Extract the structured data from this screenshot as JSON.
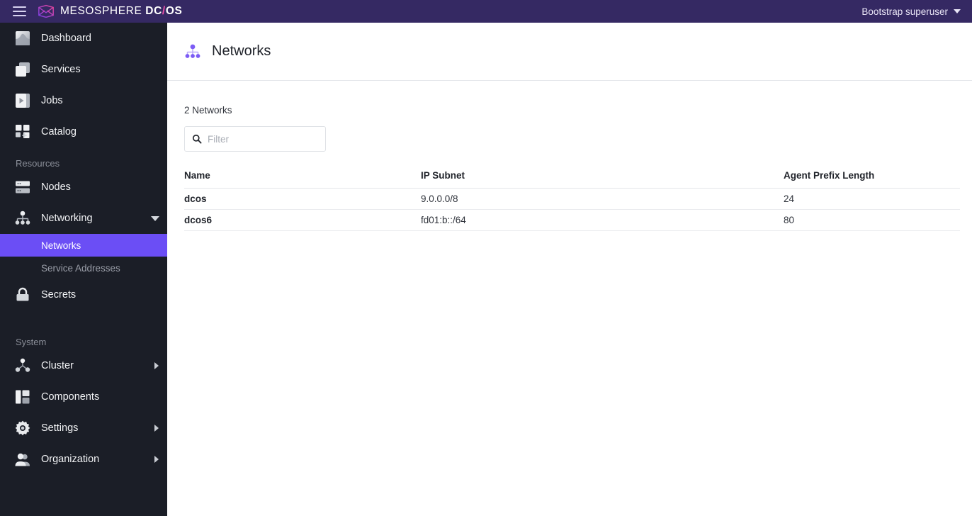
{
  "topbar": {
    "menu_icon": "hamburger-icon",
    "logo_icon": "mesosphere-envelope-logo",
    "brand_part1": "MESOSPHERE ",
    "brand_dc": "DC",
    "brand_slash": "/",
    "brand_os": "OS",
    "user_label": "Bootstrap superuser",
    "user_caret_icon": "chevron-down-icon",
    "background_color": "#352963"
  },
  "sidebar": {
    "background_color": "#1b1e27",
    "active_color": "#6b4ef5",
    "primary_items": [
      {
        "label": "Dashboard",
        "icon": "dashboard-icon"
      },
      {
        "label": "Services",
        "icon": "services-icon"
      },
      {
        "label": "Jobs",
        "icon": "jobs-icon"
      },
      {
        "label": "Catalog",
        "icon": "catalog-icon"
      }
    ],
    "resources_title": "Resources",
    "resources_items": [
      {
        "label": "Nodes",
        "icon": "nodes-icon"
      },
      {
        "label": "Networking",
        "icon": "networking-icon"
      }
    ],
    "networking_children": [
      {
        "label": "Networks",
        "active": true
      },
      {
        "label": "Service Addresses",
        "active": false
      }
    ],
    "secrets_item": {
      "label": "Secrets",
      "icon": "lock-icon"
    },
    "system_title": "System",
    "system_items": [
      {
        "label": "Cluster",
        "icon": "cluster-icon",
        "expandable": true
      },
      {
        "label": "Components",
        "icon": "components-icon",
        "expandable": false
      },
      {
        "label": "Settings",
        "icon": "gear-icon",
        "expandable": true
      },
      {
        "label": "Organization",
        "icon": "organization-icon",
        "expandable": true
      }
    ]
  },
  "page": {
    "title": "Networks",
    "title_icon": "networking-icon",
    "count_text": "2 Networks"
  },
  "filter": {
    "icon": "search-icon",
    "value": "",
    "placeholder": "Filter"
  },
  "table": {
    "columns": [
      "Name",
      "IP Subnet",
      "Agent Prefix Length"
    ],
    "rows": [
      {
        "name": "dcos",
        "subnet": "9.0.0.0/8",
        "prefix": "24"
      },
      {
        "name": "dcos6",
        "subnet": "fd01:b::/64",
        "prefix": "80"
      }
    ]
  }
}
